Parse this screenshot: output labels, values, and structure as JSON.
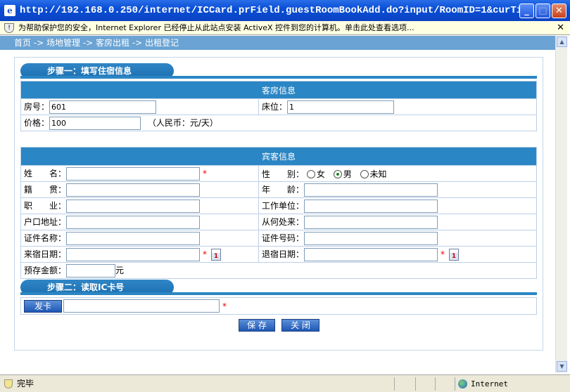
{
  "window": {
    "title": "http://192.168.0.250/internet/ICCard.prField.guestRoomBookAdd.do?input/RoomID=1&curTi...",
    "minimize_label": "_",
    "maximize_label": "□",
    "close_label": "✕"
  },
  "infobar": {
    "text": "为帮助保护您的安全，Internet Explorer 已经停止从此站点安装 ActiveX 控件到您的计算机。单击此处查看选项...",
    "close_label": "✕"
  },
  "breadcrumb": "首页 -> 场地管理 -> 客房出租 -> 出租登记",
  "step1": {
    "title": "步骤一：填写住宿信息",
    "room_section": "客房信息",
    "room_no_label": "房号：",
    "room_no_value": "601",
    "bed_label": "床位：",
    "bed_value": "1",
    "price_label": "价格：",
    "price_value": "100",
    "price_unit": "（人民币：元/天）"
  },
  "guest": {
    "section": "宾客信息",
    "name_label": "姓　　名：",
    "gender_label": "性　　别：",
    "gender_options": [
      "女",
      "男",
      "未知"
    ],
    "gender_selected": "男",
    "origin_label": "籍　　贯：",
    "age_label": "年　　龄：",
    "job_label": "职　　业：",
    "employer_label": "工作单位：",
    "address_label": "户口地址：",
    "from_label": "从何处来：",
    "id_type_label": "证件名称：",
    "id_no_label": "证件号码：",
    "checkin_label": "来宿日期：",
    "checkout_label": "退宿日期：",
    "deposit_label": "预存金额：",
    "deposit_unit": "元",
    "required_mark": "*",
    "calendar_glyph": "1"
  },
  "step2": {
    "title": "步骤二：读取IC卡号",
    "issue_card_button": "发卡",
    "card_value": ""
  },
  "actions": {
    "save_button": "保 存",
    "close_button": "关 闭"
  },
  "statusbar": {
    "status_text": "完毕",
    "zone_text": "Internet"
  },
  "colors": {
    "title_bar": "#0a4fd6",
    "section_header": "#2a86c4",
    "breadcrumb_bg": "#6aa3d4",
    "required": "#e00000"
  }
}
